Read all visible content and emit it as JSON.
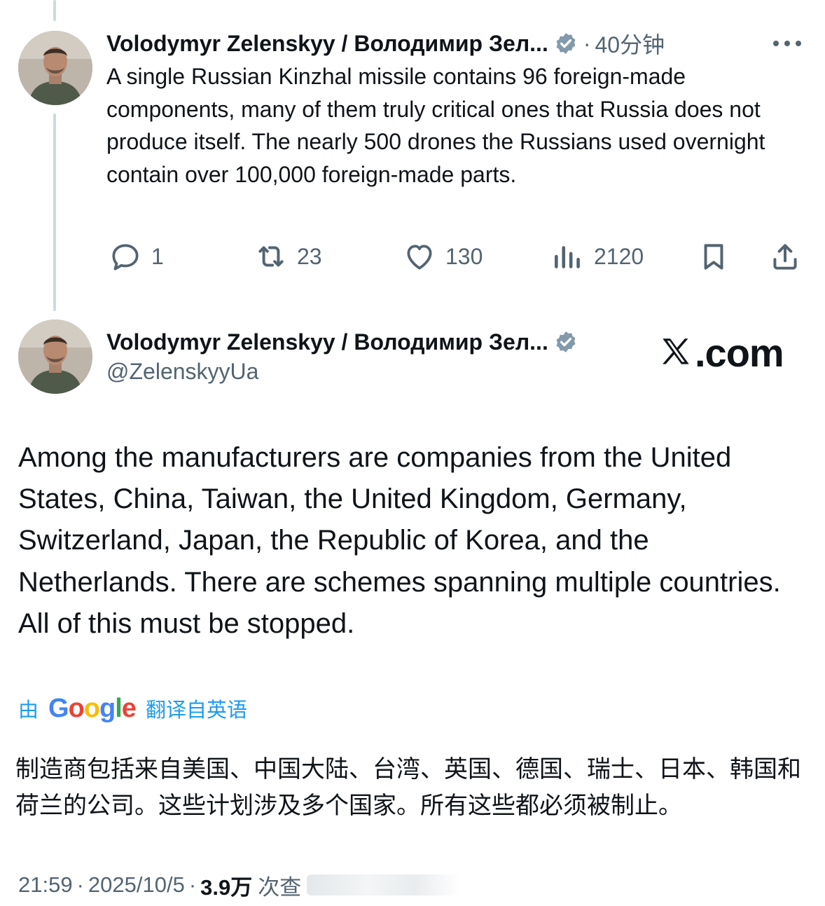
{
  "reply_tweet": {
    "display_name": "Volodymyr Zelenskyy / Володимир Зел...",
    "separator": "·",
    "time_ago": "40分钟",
    "text": "A single Russian Kinzhal missile contains 96 foreign-made components, many of them truly critical ones that Russia does not produce itself. The nearly 500 drones the Russians used overnight contain over 100,000 foreign-made parts.",
    "actions": {
      "replies": "1",
      "reposts": "23",
      "likes": "130",
      "views": "2120"
    },
    "icons": [
      "more-icon",
      "reply-icon",
      "repost-icon",
      "like-icon",
      "views-icon",
      "bookmark-icon",
      "share-icon"
    ]
  },
  "main_tweet": {
    "display_name": "Volodymyr Zelenskyy / Володимир Зел...",
    "handle": "@ZelenskyyUa",
    "watermark": ".com",
    "text": "Among the manufacturers are companies from the United States, China, Taiwan, the United Kingdom, Germany, Switzerland, Japan, the Republic of Korea, and the Netherlands. There are schemes spanning multiple countries. All of this must be stopped.",
    "translation": {
      "prefix": "由",
      "provider": "Google",
      "suffix": "翻译自英语",
      "text": "制造商包括来自美国、中国大陆、台湾、英国、德国、瑞士、日本、韩国和荷兰的公司。这些计划涉及多个国家。所有这些都必须被制止。"
    },
    "footer": {
      "time": "21:59",
      "separator": "·",
      "date": "2025/10/5",
      "views_count": "3.9万",
      "views_label": "次查"
    }
  },
  "colors": {
    "text": "#0f1419",
    "muted": "#536471",
    "link": "#1d9bf0",
    "verified_badge": "#829aab",
    "thread_line": "#cfd9de",
    "google_blue": "#4285f4",
    "google_red": "#ea4335",
    "google_yellow": "#fbbc05",
    "google_green": "#34a853"
  }
}
